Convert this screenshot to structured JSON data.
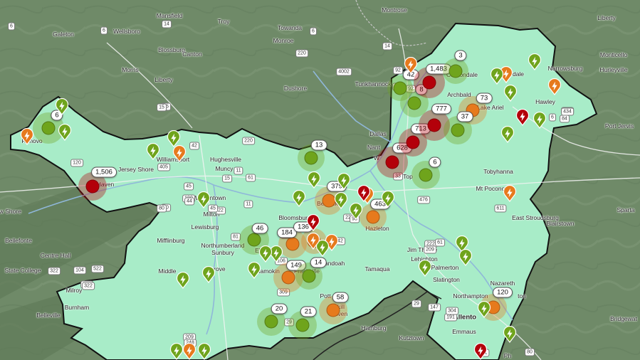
{
  "map": {
    "colors": {
      "service_area": "#a8ecc8",
      "outside": "#6f8a68",
      "border": "#111111",
      "red": "#b3000a",
      "orange": "#e67a1d",
      "green": "#6fa41c"
    },
    "places": [
      {
        "id": "mansfield",
        "name": "Mansfield"
      },
      {
        "id": "troy",
        "name": "Troy"
      },
      {
        "id": "montrose",
        "name": "Montrose"
      },
      {
        "id": "liberty_ny",
        "name": "Liberty"
      },
      {
        "id": "galeton",
        "name": "Galeton"
      },
      {
        "id": "wellsboro",
        "name": "Wellsboro"
      },
      {
        "id": "blossburg",
        "name": "Blossburg"
      },
      {
        "id": "towanda",
        "name": "Towanda"
      },
      {
        "id": "monroe",
        "name": "Monroe"
      },
      {
        "id": "canton",
        "name": "Canton"
      },
      {
        "id": "morris",
        "name": "Morris"
      },
      {
        "id": "liberty",
        "name": "Liberty"
      },
      {
        "id": "dushore",
        "name": "Dushore"
      },
      {
        "id": "tunkhannock",
        "name": "Tunkhannock"
      },
      {
        "id": "carbondale",
        "name": "Carbondale"
      },
      {
        "id": "honesdale",
        "name": "dale"
      },
      {
        "id": "narrowsburg",
        "name": "Narrowsburg"
      },
      {
        "id": "monticello",
        "name": "Monticello"
      },
      {
        "id": "hurleyville",
        "name": "Hurleyville"
      },
      {
        "id": "archbald",
        "name": "Archbald"
      },
      {
        "id": "hawley",
        "name": "Hawley"
      },
      {
        "id": "lake_ariel",
        "name": "Lake Ariel"
      },
      {
        "id": "renovo",
        "name": "Renovo"
      },
      {
        "id": "dallas",
        "name": "Dallas"
      },
      {
        "id": "port_jervis",
        "name": "Port Jervis"
      },
      {
        "id": "williamsport",
        "name": "Williamsport"
      },
      {
        "id": "hughesville",
        "name": "Hughesville"
      },
      {
        "id": "muncy",
        "name": "Muncy"
      },
      {
        "id": "jersey_shore",
        "name": "Jersey Shore"
      },
      {
        "id": "lock_haven",
        "name": "Haven"
      },
      {
        "id": "tobyhanna",
        "name": "Tobyhanna"
      },
      {
        "id": "mt_pocono",
        "name": "Mt Pocono"
      },
      {
        "id": "watsontown",
        "name": "Watsontown"
      },
      {
        "id": "berwick",
        "name": "Berwick"
      },
      {
        "id": "milton",
        "name": "Milton"
      },
      {
        "id": "bloomsburg",
        "name": "Bloomsburg"
      },
      {
        "id": "hazleton",
        "name": "Hazleton"
      },
      {
        "id": "east_stroudsburg",
        "name": "East Stroudsburg"
      },
      {
        "id": "blairstown",
        "name": "Blairstown"
      },
      {
        "id": "sparta",
        "name": "Sparta"
      },
      {
        "id": "lewisburg",
        "name": "Lewisburg"
      },
      {
        "id": "mifflinburg",
        "name": "Mifflinburg"
      },
      {
        "id": "bellefonte",
        "name": "Bellefonte"
      },
      {
        "id": "pleasant_gap",
        "name": "ew Shore"
      },
      {
        "id": "northumberland",
        "name": "Northumberland"
      },
      {
        "id": "sunbury",
        "name": "Sunbury"
      },
      {
        "id": "jim_thorpe",
        "name": "Jim Thorpe"
      },
      {
        "id": "lehighton",
        "name": "Lehighton"
      },
      {
        "id": "centre_hall",
        "name": "Centre Hall"
      },
      {
        "id": "shamokin",
        "name": "Shamokin"
      },
      {
        "id": "shenandoah",
        "name": "henandoah"
      },
      {
        "id": "frackville",
        "name": "Frackville"
      },
      {
        "id": "palmerton",
        "name": "Palmerton"
      },
      {
        "id": "state_college",
        "name": "State College"
      },
      {
        "id": "middleburg",
        "name": "Middle"
      },
      {
        "id": "selinsgrove",
        "name": "grove"
      },
      {
        "id": "tamaqua",
        "name": "Tamaqua"
      },
      {
        "id": "slatington",
        "name": "Slatington"
      },
      {
        "id": "milroy",
        "name": "Milroy"
      },
      {
        "id": "nazareth",
        "name": "Nazareth"
      },
      {
        "id": "northampton",
        "name": "Northampton"
      },
      {
        "id": "burnham",
        "name": "Burnham"
      },
      {
        "id": "belleville",
        "name": "Belleville"
      },
      {
        "id": "pottsville",
        "name": "Pott"
      },
      {
        "id": "schuylkill",
        "name": "kill"
      },
      {
        "id": "haven2",
        "name": "aven"
      },
      {
        "id": "allentown",
        "name": "Allento"
      },
      {
        "id": "bridgewater",
        "name": "Bridgewat"
      },
      {
        "id": "hamburg",
        "name": "Hamburg"
      },
      {
        "id": "kutztown",
        "name": "Kutztown"
      },
      {
        "id": "emmaus",
        "name": "Emmaus"
      },
      {
        "id": "easton",
        "name": "ton"
      },
      {
        "id": "elysburg",
        "name": "Ely"
      },
      {
        "id": "top",
        "name": "Top"
      },
      {
        "id": "nant",
        "name": "Nant"
      },
      {
        "id": "wilkes",
        "name": "W"
      },
      {
        "id": "phillipsburg",
        "name": "Ph"
      }
    ],
    "shields": [
      "6",
      "6",
      "14",
      "6",
      "220",
      "14",
      "4002",
      "92",
      "29",
      "6",
      "191",
      "120",
      "220",
      "15",
      "42",
      "405",
      "11",
      "61",
      "45",
      "180",
      "15",
      "44",
      "22",
      "80",
      "11",
      "81",
      "309",
      "106",
      "33",
      "476",
      "22",
      "222",
      "61",
      "611",
      "80",
      "147",
      "322",
      "322",
      "522",
      "104",
      "209",
      "248",
      "80",
      "15",
      "54",
      "442",
      "93",
      "611",
      "191",
      "29",
      "304",
      "92",
      "92",
      "434",
      "84",
      "209",
      "322",
      "45",
      "29"
    ],
    "clusters": [
      {
        "count": "1,506",
        "level": "red"
      },
      {
        "count": "6",
        "level": "green"
      },
      {
        "count": "13",
        "level": "green"
      },
      {
        "count": "379",
        "level": "orange"
      },
      {
        "count": "463",
        "level": "orange"
      },
      {
        "count": "628",
        "level": "red"
      },
      {
        "count": "713",
        "level": "red"
      },
      {
        "count": "777",
        "level": "red"
      },
      {
        "count": "8",
        "level": "green"
      },
      {
        "count": "42",
        "level": "green"
      },
      {
        "count": "1,483",
        "level": "red"
      },
      {
        "count": "3",
        "level": "green"
      },
      {
        "count": "73",
        "level": "orange"
      },
      {
        "count": "37",
        "level": "green"
      },
      {
        "count": "6",
        "level": "green"
      },
      {
        "count": "46",
        "level": "green"
      },
      {
        "count": "184",
        "level": "orange"
      },
      {
        "count": "136",
        "level": "orange"
      },
      {
        "count": "149",
        "level": "orange"
      },
      {
        "count": "14",
        "level": "green"
      },
      {
        "count": "58",
        "level": "orange"
      },
      {
        "count": "20",
        "level": "green"
      },
      {
        "count": "21",
        "level": "green"
      },
      {
        "count": "120",
        "level": "orange"
      }
    ],
    "pins": [
      {
        "level": "orange"
      },
      {
        "level": "orange"
      },
      {
        "level": "green"
      },
      {
        "level": "green"
      },
      {
        "level": "green"
      },
      {
        "level": "green"
      },
      {
        "level": "orange"
      },
      {
        "level": "green"
      },
      {
        "level": "orange"
      },
      {
        "level": "orange"
      },
      {
        "level": "green"
      },
      {
        "level": "green"
      },
      {
        "level": "green"
      },
      {
        "level": "red"
      },
      {
        "level": "green"
      },
      {
        "level": "green"
      },
      {
        "level": "orange"
      },
      {
        "level": "green"
      },
      {
        "level": "green"
      },
      {
        "level": "green"
      },
      {
        "level": "red"
      },
      {
        "level": "green"
      },
      {
        "level": "red"
      },
      {
        "level": "orange"
      },
      {
        "level": "orange"
      },
      {
        "level": "green"
      },
      {
        "level": "green"
      },
      {
        "level": "green"
      },
      {
        "level": "green"
      },
      {
        "level": "green"
      },
      {
        "level": "orange"
      },
      {
        "level": "green"
      },
      {
        "level": "green"
      },
      {
        "level": "green"
      },
      {
        "level": "green"
      },
      {
        "level": "green"
      },
      {
        "level": "green"
      },
      {
        "level": "green"
      },
      {
        "level": "green"
      },
      {
        "level": "red"
      },
      {
        "level": "orange"
      },
      {
        "level": "green"
      },
      {
        "level": "green"
      }
    ]
  }
}
